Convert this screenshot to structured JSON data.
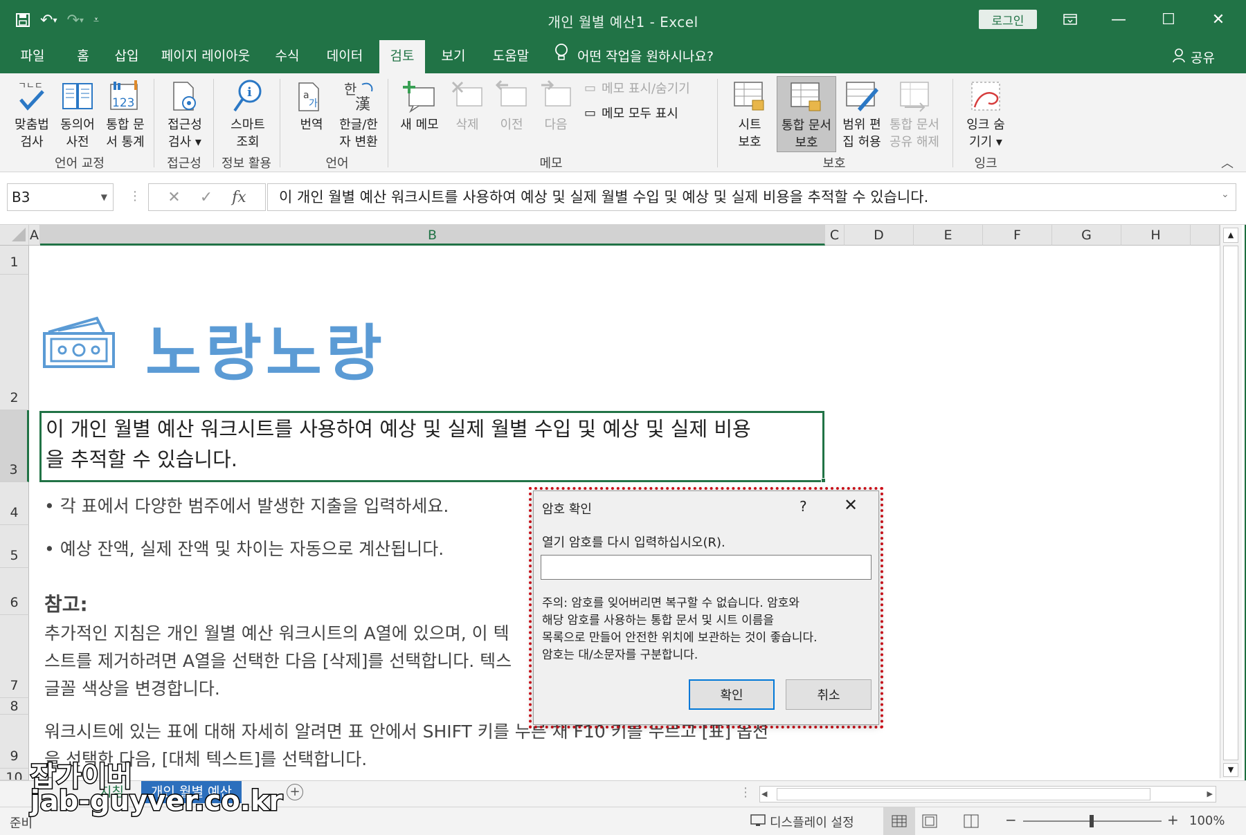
{
  "titlebar": {
    "title": "개인 월별 예산1  -  Excel",
    "login": "로그인"
  },
  "tabs": [
    "파일",
    "홈",
    "삽입",
    "페이지 레이아웃",
    "수식",
    "데이터",
    "검토",
    "보기",
    "도움말"
  ],
  "active_tab": "검토",
  "tell_me": "어떤 작업을 원하시나요?",
  "share": "공유",
  "ribbon": {
    "spell_1": "맞춤법",
    "spell_2": "검사",
    "thes_1": "동의어",
    "thes_2": "사전",
    "stats_1": "통합 문",
    "stats_2": "서 통계",
    "proofing": "언어 교정",
    "access_1": "접근성",
    "access_2": "검사 ▾",
    "access_group": "접근성",
    "smart_1": "스마트",
    "smart_2": "조회",
    "insights_group": "정보 활용",
    "translate": "번역",
    "hanja_1": "한글/한",
    "hanja_2": "자 변환",
    "language_group": "언어",
    "new_comment": "새 메모",
    "delete": "삭제",
    "previous": "이전",
    "next": "다음",
    "show_hide": "메모 표시/숨기기",
    "show_all": "메모 모두 표시",
    "comments_group": "메모",
    "protect_sheet_1": "시트",
    "protect_sheet_2": "보호",
    "protect_wb_1": "통합 문서",
    "protect_wb_2": "보호",
    "allow_edit_1": "범위 편",
    "allow_edit_2": "집 허용",
    "unshare_1": "통합 문서",
    "unshare_2": "공유 해제",
    "protect_group": "보호",
    "ink_1": "잉크 숨",
    "ink_2": "기기 ▾",
    "ink_group": "잉크"
  },
  "formula_bar": {
    "name_box": "B3",
    "fx": "fx",
    "formula": "이 개인 월별 예산 워크시트를 사용하여 예상 및 실제 월별 수입 및 예상 및 실제 비용을 추적할 수 있습니다."
  },
  "columns": [
    "A",
    "B",
    "C",
    "D",
    "E",
    "F",
    "G",
    "H"
  ],
  "rows": [
    "1",
    "2",
    "3",
    "4",
    "5",
    "6",
    "7",
    "8",
    "9",
    "10"
  ],
  "sheet": {
    "title": "노랑노랑",
    "b3_line1": "이 개인 월별 예산 워크시트를 사용하여 예상 및 실제 월별 수입 및 예상 및 실제 비용",
    "b3_line2": "을 추적할 수 있습니다.",
    "row4": "• 각 표에서 다양한 범주에서 발생한 지출을 입력하세요.",
    "row5": "• 예상 잔액, 실제 잔액 및 차이는 자동으로 계산됩니다.",
    "note_title": "참고:",
    "row6_line": "추가적인 지침은 개인 월별 예산 워크시트의 A열에 있으며, 이 텍",
    "row7_line1": "스트를 제거하려면 A열을 선택한 다음 [삭제]를 선택합니다. 텍스",
    "row7_line2": "글꼴 색상을 변경합니다.",
    "row9_line1": "워크시트에 있는 표에 대해 자세히 알려면 표 안에서 SHIFT 키를 누른 채 F10 키를 누르고 [표] 옵션",
    "row9_line2": "을 선택한 다음, [대체 텍스트]를 선택합니다."
  },
  "dialog": {
    "title": "암호 확인",
    "help": "?",
    "label": "열기 암호를 다시 입력하십시오(R).",
    "input_value": "",
    "note_1": "주의: 암호를 잊어버리면 복구할 수 없습니다. 암호와",
    "note_2": "해당 암호를 사용하는 통합 문서 및 시트 이름을",
    "note_3": "목록으로 만들어 안전한 위치에 보관하는 것이 좋습니다.",
    "note_4": "암호는 대/소문자를 구분합니다.",
    "ok": "확인",
    "cancel": "취소"
  },
  "sheet_tabs": [
    "지침",
    "개인 월별 예산"
  ],
  "status": {
    "ready": "준비",
    "display_settings": "디스플레이 설정",
    "zoom": "100%",
    "zoom_minus": "−",
    "zoom_plus": "+"
  },
  "watermark": {
    "line1": "잡가이버",
    "line2": "jab-guyver.co.kr"
  },
  "colors": {
    "excel_green": "#217346",
    "title_blue": "#5b9bd5",
    "highlight_red": "#d0121b",
    "active_sheet_tab": "#2c6fbd"
  }
}
